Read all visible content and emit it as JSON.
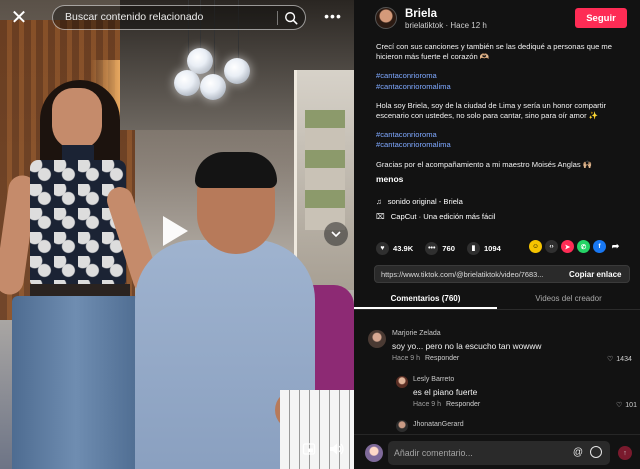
{
  "video": {
    "close_icon": "close-icon",
    "search": {
      "placeholder": "Buscar contenido relacionado",
      "icon": "search-icon"
    },
    "more_icon": "more-horizontal-icon",
    "more_glyph": "•••",
    "play_icon": "play-icon",
    "nav_icon": "chevron-down-icon",
    "bottom_icons": [
      "picture-in-picture-icon",
      "volume-icon"
    ]
  },
  "author": {
    "name": "Briela",
    "handle_time": "brielatiktok · Hace 12 h",
    "follow_label": "Seguir"
  },
  "description": {
    "para1": "Crecí con sus canciones y también se las dediqué a personas que me hicieron más fuerte el corazón 🫶🏼",
    "tags1": [
      "#cantaconrioroma",
      "#cantaconrioromalima"
    ],
    "para2": "Hola soy Briela, soy de la ciudad de Lima y sería un honor compartir escenario con ustedes, no solo para cantar, sino para oír amor ✨",
    "tags2": [
      "#cantaconrioroma",
      "#cantaconrioromalima"
    ],
    "para3": "Gracias por el acompañamiento a mi maestro Moisés Anglas 🙌🏼",
    "less": "menos",
    "sound": "sonido original - Briela",
    "capcut": "CapCut · Una edición más fácil"
  },
  "stats": {
    "likes": "43.9K",
    "comments": "760",
    "saves": "1094"
  },
  "colors": {
    "accent": "#fe2c55",
    "hashtag": "#7ea8ff",
    "background": "#121212"
  },
  "link": {
    "url": "https://www.tiktok.com/@brielatiktok/video/7683...",
    "copy_label": "Copiar enlace"
  },
  "tabs": {
    "comments": "Comentarios (760)",
    "creator_videos": "Videos del creador"
  },
  "comments": [
    {
      "name": "Marjorie Zelada",
      "text": "soy yo... pero no la escucho tan wowww",
      "time": "Hace 9 h",
      "reply": "Responder",
      "likes": "1434"
    },
    {
      "name": "Lesly Barreto",
      "text": "es el piano fuerte",
      "time": "Hace 9 h",
      "reply": "Responder",
      "likes": "101"
    },
    {
      "name": "JhonatanGerard"
    }
  ],
  "composer": {
    "placeholder": "Añadir comentario..."
  }
}
